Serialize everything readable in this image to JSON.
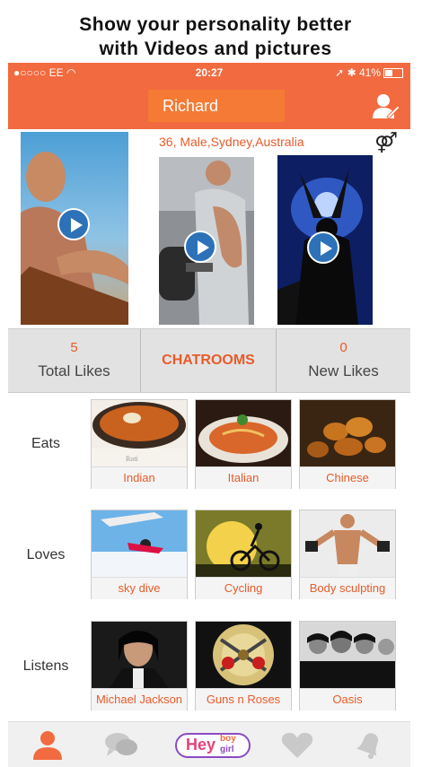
{
  "promo": {
    "line1": "Show your personality better",
    "line2": "with Videos and pictures"
  },
  "status_bar": {
    "carrier": "●○○○○ EE",
    "time": "20:27",
    "battery_text": "41%"
  },
  "header": {
    "name": "Richard"
  },
  "profile": {
    "info": "36, Male,Sydney,Australia",
    "gender_icon": "gender-icon"
  },
  "stats": {
    "total_likes_count": "5",
    "total_likes_label": "Total Likes",
    "chatrooms_label": "CHATROOMS",
    "new_likes_count": "0",
    "new_likes_label": "New Likes"
  },
  "rows": [
    {
      "label": "Eats",
      "items": [
        "Indian",
        "Italian",
        "Chinese"
      ]
    },
    {
      "label": "Loves",
      "items": [
        "sky dive",
        "Cycling",
        "Body sculpting"
      ]
    },
    {
      "label": "Listens",
      "items": [
        "Michael Jackson",
        "Guns n Roses",
        "Oasis"
      ]
    }
  ],
  "tabbar": {
    "logo_text": "Hey",
    "logo_small_1": "boy",
    "logo_small_2": "girl",
    "icons": [
      "profile-icon",
      "chat-icon",
      "heyboygirl-logo",
      "heart-icon",
      "bell-icon"
    ]
  },
  "colors": {
    "accent": "#f26a3f",
    "accent_text": "#e85b2a",
    "play_button": "#2d72b8"
  }
}
